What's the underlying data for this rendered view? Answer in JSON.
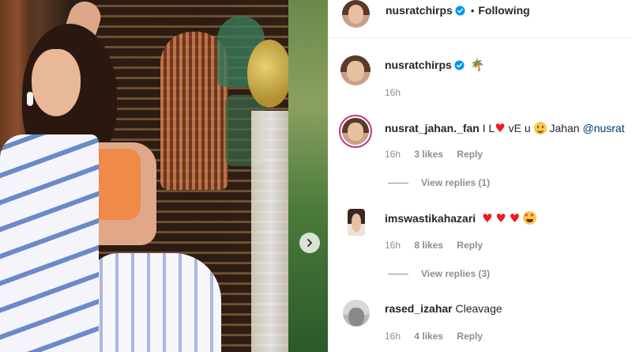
{
  "header": {
    "username": "nusratchirps",
    "separator": "•",
    "follow_status": "Following"
  },
  "caption": {
    "username": "nusratchirps",
    "emoji": "🌴",
    "time": "16h"
  },
  "comments": [
    {
      "username": "nusrat_jahan._fan",
      "text_before": "I L",
      "heart": "♥",
      "text_mid": "vE u",
      "text_after": "Jahan",
      "mention": "@nusrat",
      "time": "16h",
      "likes": "3 likes",
      "reply": "Reply",
      "view_replies": "View replies (1)"
    },
    {
      "username": "imswastikahazari",
      "hearts": [
        "♥",
        "♥",
        "♥"
      ],
      "time": "16h",
      "likes": "8 likes",
      "reply": "Reply",
      "view_replies": "View replies (3)"
    },
    {
      "username": "rased_izahar",
      "text": "Cleavage",
      "time": "16h",
      "likes": "4 likes",
      "reply": "Reply"
    }
  ],
  "colors": {
    "verified": "#0095f6",
    "heart": "#ed1c24",
    "story_ring": "#c13584",
    "muted_text": "#8e8e8e",
    "mention": "#00376b"
  },
  "icons": {
    "next": "chevron-right-icon",
    "verified": "verified-badge-icon"
  }
}
